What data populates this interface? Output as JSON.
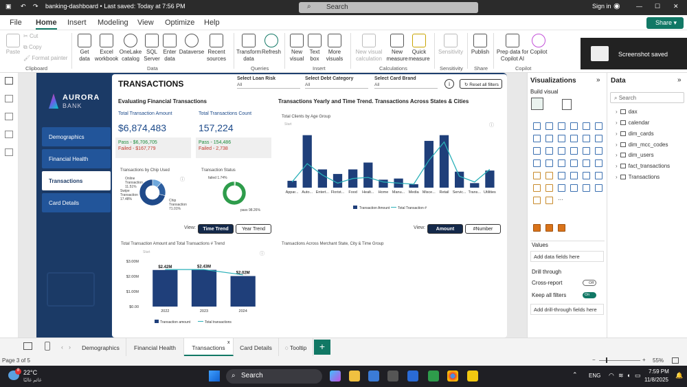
{
  "window": {
    "file_title": "banking-dashboard • Last saved: Today at 7:56 PM",
    "search_placeholder": "Search",
    "signin": "Sign in"
  },
  "menu": {
    "tabs": [
      "File",
      "Home",
      "Insert",
      "Modeling",
      "View",
      "Optimize",
      "Help"
    ],
    "active": "Home",
    "share": "Share"
  },
  "ribbon": {
    "clipboard": {
      "paste": "Paste",
      "cut": "Cut",
      "copy": "Copy",
      "format_painter": "Format painter",
      "group": "Clipboard"
    },
    "data": {
      "get_data": "Get data",
      "excel": "Excel workbook",
      "onelake": "OneLake catalog",
      "sql": "SQL Server",
      "enter": "Enter data",
      "dataverse": "Dataverse",
      "recent": "Recent sources",
      "group": "Data"
    },
    "queries": {
      "transform": "Transform data",
      "refresh": "Refresh",
      "group": "Queries"
    },
    "insert": {
      "new_visual": "New visual",
      "text_box": "Text box",
      "more_visuals": "More visuals",
      "group": "Insert"
    },
    "calculations": {
      "new_visual_calc": "New visual calculation",
      "new_measure": "New measure",
      "quick_measure": "Quick measure",
      "group": "Calculations"
    },
    "sensitivity": {
      "label": "Sensitivity",
      "group": "Sensitivity"
    },
    "share": {
      "publish": "Publish",
      "group": "Share"
    },
    "copilot": {
      "prep": "Prep data for Copilot AI",
      "copilot": "Copilot",
      "group": "Copilot"
    }
  },
  "toast": "Screenshot saved",
  "report": {
    "brand1": "AURORA",
    "brand2": "BANK",
    "nav": [
      "Demographics",
      "Financial Health",
      "Transactions",
      "Card Details"
    ],
    "nav_active": "Transactions",
    "title": "TRANSACTIONS",
    "filters": [
      {
        "label": "Select Loan Risk",
        "value": "All"
      },
      {
        "label": "Select Debt Category",
        "value": "All"
      },
      {
        "label": "Select Card Brand",
        "value": "All"
      }
    ],
    "reset": "Reset all filters",
    "left_heading": "Evaluating Financial Transactions",
    "right_heading": "Transactions Yearly and Time Trend. Transactions Across States & Cities",
    "amount_label": "Total Transaction Amount",
    "amount_value": "$6,874,483",
    "amount_pass": "Pass - $6,706,705",
    "amount_fail": "Failed - $167,779",
    "count_label": "Total Transactions Count",
    "count_value": "157,224",
    "count_pass": "Pass - 154,486",
    "count_fail": "Failed - 2,738",
    "chip_title": "Transactions by Chip Used",
    "chip_labels": [
      "Online Transaction 11.51%",
      "Swipe Transaction 17.48%",
      "Chip Transaction 71.01%"
    ],
    "status_title": "Transaction Status",
    "status_labels": [
      "failed 1.74%",
      "pass 98.26%"
    ],
    "view_label": "View:",
    "time_trend": "Time Trend",
    "year_trend": "Year Trend",
    "amount_btn": "Amount",
    "number_btn": "#Number",
    "merchant_title": "Transactions Across Merchant State, City & Time Group",
    "start_hint": "Start"
  },
  "chart_data": [
    {
      "type": "bar",
      "title": "Total Clients by Age Group",
      "categories": [
        "Appar...",
        "Auto...",
        "Entert...",
        "Florist...",
        "Food",
        "Healt...",
        "Home",
        "Manu...",
        "Media",
        "Misce...",
        "Retail",
        "Servic...",
        "Trans...",
        "Utilities"
      ],
      "series": [
        {
          "name": "Transaction Amount",
          "values": [
            0.6,
            4.6,
            1.6,
            1.2,
            1.6,
            2.2,
            0.7,
            0.8,
            0.3,
            4.1,
            4.6,
            1.4,
            0.4,
            1.5
          ]
        },
        {
          "name": "Total Transaction #",
          "type": "line",
          "values": [
            0.5,
            2.1,
            1.1,
            0.4,
            0.8,
            0.9,
            0.5,
            0.4,
            0.3,
            2.4,
            4.0,
            1.0,
            0.5,
            1.6
          ]
        }
      ],
      "legend": "bottom"
    },
    {
      "type": "bar",
      "title": "Total Transaction Amount and Total Transactions # Trend",
      "categories": [
        "2022",
        "2023",
        "2024"
      ],
      "series": [
        {
          "name": "Transaction amount",
          "values": [
            2.42,
            2.43,
            2.02
          ]
        },
        {
          "name": "Total transactions",
          "type": "line",
          "values": [
            2.45,
            2.45,
            2.1
          ]
        }
      ],
      "data_labels": [
        "$2.42M",
        "$2.43M",
        "$2.02M"
      ],
      "yticks": [
        "$0.00",
        "$1.00M",
        "$2.00M",
        "$3.00M"
      ],
      "ylim": [
        0,
        3
      ],
      "legend": "bottom"
    },
    {
      "type": "pie",
      "title": "Transactions by Chip Used",
      "labels": [
        "Online Transaction",
        "Swipe Transaction",
        "Chip Transaction"
      ],
      "values": [
        11.51,
        17.48,
        71.01
      ]
    },
    {
      "type": "pie",
      "title": "Transaction Status",
      "labels": [
        "failed",
        "pass"
      ],
      "values": [
        1.74,
        98.26
      ]
    }
  ],
  "viz_pane": {
    "title": "Visualizations",
    "build": "Build visual",
    "values": "Values",
    "add_fields": "Add data fields here",
    "drill": "Drill through",
    "cross": "Cross-report",
    "cross_state": "Off",
    "keep": "Keep all filters",
    "keep_state": "On",
    "add_drill": "Add drill-through fields here"
  },
  "data_pane": {
    "title": "Data",
    "search": "Search",
    "tables": [
      "dax",
      "calendar",
      "dim_cards",
      "dim_mcc_codes",
      "dim_users",
      "fact_transactions",
      "Transactions"
    ]
  },
  "pages": {
    "tabs": [
      "Demographics",
      "Financial Health",
      "Transactions",
      "Card Details",
      "Tooltip"
    ],
    "active": "Transactions",
    "add": "+"
  },
  "status": {
    "page": "Page 3 of 5",
    "zoom": "55%"
  },
  "taskbar": {
    "temp": "22°C",
    "weather": "غائم غالبًا",
    "search": "Search",
    "lang": "ENG",
    "time": "7:59 PM",
    "date": "11/8/2025",
    "badge": "8"
  },
  "colors": {
    "accent": "#117865",
    "navy": "#1b3a66",
    "bar": "#1f3f7a",
    "line": "#2ab0b8",
    "donut_green": "#2e9c4b"
  }
}
